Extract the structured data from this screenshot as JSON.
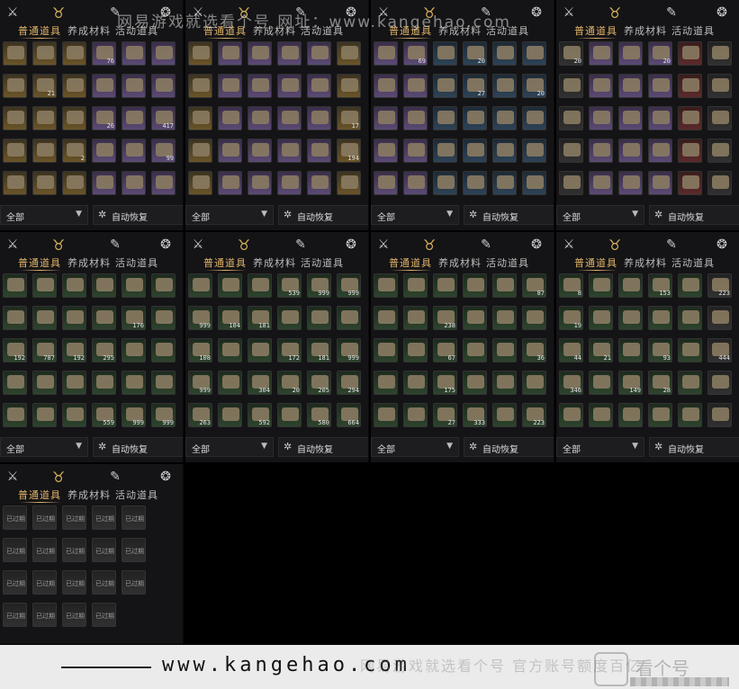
{
  "watermark_top": "网易游戏就选看个号 网址：www.kangehao.com",
  "footer": {
    "url": "www.kangehao.com",
    "ghost_text": "网易游戏就选看个号 官方账号额度百亿",
    "brand": "看个号"
  },
  "ui_text": {
    "tabs": [
      "普通道具",
      "养成材料",
      "活动道具"
    ],
    "filter_label": "全部",
    "filter_caret": "▼",
    "auto_restore_label": "自动恢复",
    "expired_label": "已过期"
  },
  "icons": {
    "close": "crossed-swords-icon",
    "bag": "coin-pouch-icon",
    "scroll": "scroll-icon",
    "ring": "ring-icon",
    "gear": "gear-icon"
  },
  "colors": {
    "accent_gold": "#e2b46a",
    "panel_bg": "#141416",
    "rarity_purple": "#5b4a74",
    "rarity_gold": "#6a5428",
    "rarity_blue": "#2e4256",
    "rarity_green": "#2d432d"
  },
  "panels": [
    {
      "rows": [
        [
          "",
          "",
          "",
          "76",
          "",
          ""
        ],
        [
          "",
          "21",
          "",
          "",
          "",
          ""
        ],
        [
          "",
          "",
          "",
          "26",
          "",
          "417"
        ],
        [
          "",
          "",
          "2",
          "",
          "",
          "99"
        ],
        [
          "",
          "",
          "",
          "",
          "",
          ""
        ]
      ],
      "rarity": [
        "gold",
        "gold",
        "gold",
        "purple",
        "purple",
        "purple"
      ]
    },
    {
      "rows": [
        [
          "",
          "",
          "",
          "",
          "",
          ""
        ],
        [
          "",
          "",
          "",
          "",
          "",
          ""
        ],
        [
          "",
          "",
          "",
          "",
          "",
          "17"
        ],
        [
          "",
          "",
          "",
          "",
          "",
          "194"
        ],
        [
          "",
          "",
          "",
          "",
          "",
          ""
        ]
      ],
      "rarity": [
        "gold",
        "purple",
        "purple",
        "purple",
        "purple",
        "gold"
      ]
    },
    {
      "rows": [
        [
          "",
          "69",
          "",
          "20",
          "",
          ""
        ],
        [
          "",
          "",
          "",
          "27",
          "",
          "20"
        ],
        [
          "",
          "",
          "",
          "",
          "",
          ""
        ],
        [
          "",
          "",
          "",
          "",
          "",
          ""
        ],
        [
          "",
          "",
          "",
          "",
          "",
          ""
        ]
      ],
      "rarity": [
        "purple",
        "purple",
        "blue",
        "blue",
        "blue",
        "blue"
      ]
    },
    {
      "rows": [
        [
          "20",
          "",
          "",
          "20",
          "",
          ""
        ],
        [
          "",
          "",
          "",
          "",
          "",
          ""
        ],
        [
          "",
          "",
          "",
          "",
          "",
          ""
        ],
        [
          "",
          "",
          "",
          "",
          "",
          ""
        ],
        [
          "",
          "",
          "",
          "",
          "",
          ""
        ]
      ],
      "rarity": [
        "grey",
        "purple",
        "purple",
        "purple",
        "red",
        "grey"
      ]
    },
    {
      "rows": [
        [
          "",
          "",
          "",
          "",
          "",
          ""
        ],
        [
          "",
          "",
          "",
          "",
          "176",
          ""
        ],
        [
          "192",
          "787",
          "192",
          "295",
          "",
          ""
        ],
        [
          "",
          "",
          "",
          "",
          "",
          ""
        ],
        [
          "",
          "",
          "",
          "559",
          "999",
          "999"
        ]
      ],
      "rarity": [
        "green",
        "green",
        "green",
        "green",
        "green",
        "green"
      ]
    },
    {
      "rows": [
        [
          "",
          "",
          "",
          "539",
          "999",
          "999"
        ],
        [
          "999",
          "104",
          "181",
          "",
          "",
          ""
        ],
        [
          "108",
          "",
          "",
          "172",
          "181",
          "999"
        ],
        [
          "999",
          "",
          "304",
          "20",
          "205",
          "294"
        ],
        [
          "263",
          "",
          "592",
          "",
          "580",
          "664"
        ]
      ],
      "rarity": [
        "green",
        "green",
        "green",
        "green",
        "green",
        "green"
      ]
    },
    {
      "rows": [
        [
          "",
          "",
          "",
          "",
          "",
          "87"
        ],
        [
          "",
          "",
          "238",
          "",
          "",
          ""
        ],
        [
          "",
          "",
          "67",
          "",
          "",
          "36"
        ],
        [
          "",
          "",
          "175",
          "",
          "",
          ""
        ],
        [
          "",
          "",
          "27",
          "333",
          "",
          "223"
        ]
      ],
      "rarity": [
        "green",
        "green",
        "green",
        "green",
        "green",
        "green"
      ]
    },
    {
      "rows": [
        [
          "8",
          "",
          "",
          "153",
          "",
          "223"
        ],
        [
          "19",
          "",
          "",
          "",
          "",
          ""
        ],
        [
          "44",
          "21",
          "",
          "93",
          "",
          "444"
        ],
        [
          "346",
          "",
          "149",
          "28",
          "",
          ""
        ],
        [
          "",
          "",
          "",
          "",
          "",
          ""
        ]
      ],
      "rarity": [
        "green",
        "green",
        "green",
        "green",
        "green",
        "grey"
      ]
    }
  ]
}
